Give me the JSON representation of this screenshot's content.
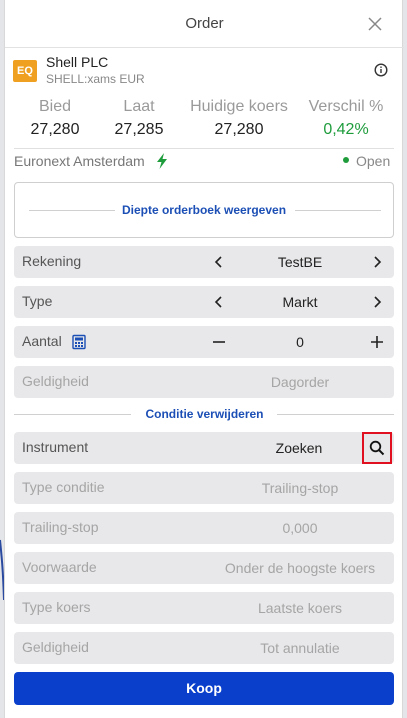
{
  "dialog": {
    "title": "Order"
  },
  "instrument": {
    "badge": "EQ",
    "name": "Shell PLC",
    "subtitle": "SHELL:xams EUR"
  },
  "quote": {
    "bid_label": "Bied",
    "bid": "27,280",
    "ask_label": "Laat",
    "ask": "27,285",
    "last_label": "Huidige koers",
    "last": "27,280",
    "diff_label": "Verschil %",
    "diff": "0,42%"
  },
  "market": {
    "name": "Euronext Amsterdam",
    "status": "Open"
  },
  "depth": {
    "label": "Diepte orderboek weergeven"
  },
  "form": {
    "account_label": "Rekening",
    "account_value": "TestBE",
    "type_label": "Type",
    "type_value": "Markt",
    "qty_label": "Aantal",
    "qty_value": "0",
    "validity_label": "Geldigheid",
    "validity_value": "Dagorder"
  },
  "condition": {
    "remove_label": "Conditie verwijderen",
    "instrument_label": "Instrument",
    "instrument_value": "Zoeken",
    "cond_type_label": "Type conditie",
    "cond_type_value": "Trailing-stop",
    "trailing_label": "Trailing-stop",
    "trailing_value": "0,000",
    "prereq_label": "Voorwaarde",
    "prereq_value": "Onder de hoogste koers",
    "price_type_label": "Type koers",
    "price_type_value": "Laatste koers",
    "validity_label": "Geldigheid",
    "validity_value": "Tot annulatie"
  },
  "actions": {
    "buy_label": "Koop"
  },
  "colors": {
    "accent": "#1c4fb5",
    "buy": "#0a3fcc",
    "positive": "#1e9c3c",
    "badge": "#f0a020",
    "highlight": "#e01020"
  }
}
